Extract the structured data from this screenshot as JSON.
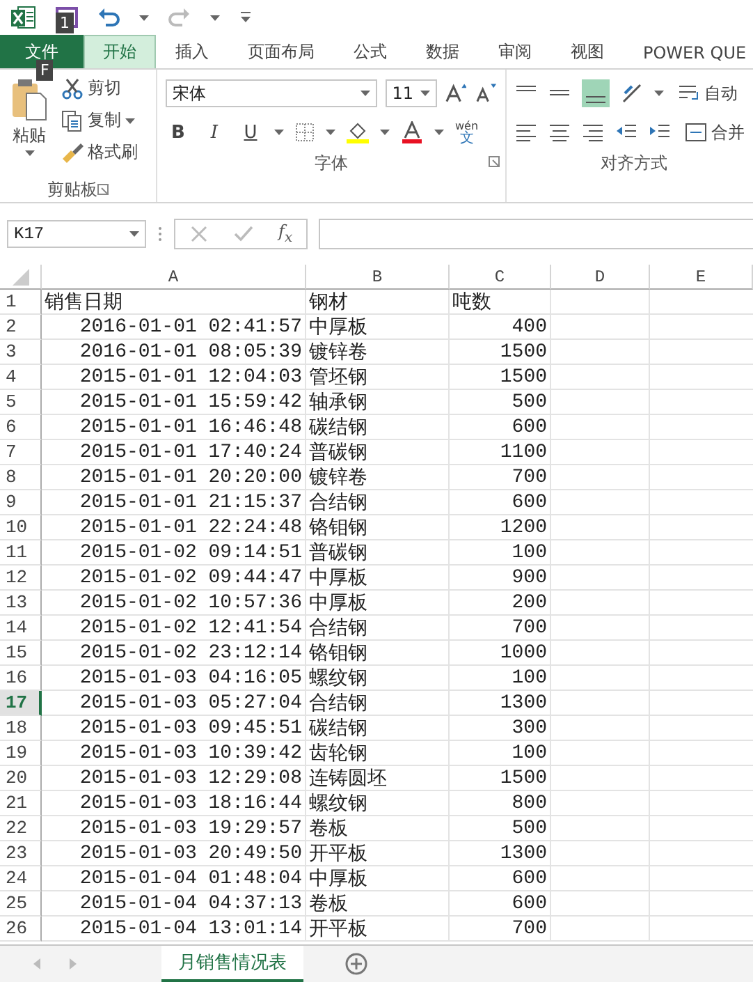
{
  "title_bar": {
    "keytip": "1"
  },
  "ribbon_tabs": [
    {
      "label": "文件",
      "kind": "file",
      "selected": false,
      "keytip": "F"
    },
    {
      "label": "开始",
      "kind": "tab",
      "selected": true
    },
    {
      "label": "插入",
      "kind": "tab",
      "selected": false
    },
    {
      "label": "页面布局",
      "kind": "tab",
      "selected": false
    },
    {
      "label": "公式",
      "kind": "tab",
      "selected": false
    },
    {
      "label": "数据",
      "kind": "tab",
      "selected": false
    },
    {
      "label": "审阅",
      "kind": "tab",
      "selected": false
    },
    {
      "label": "视图",
      "kind": "tab",
      "selected": false
    },
    {
      "label": "POWER QUE",
      "kind": "tab",
      "selected": false
    }
  ],
  "clipboard": {
    "paste": "粘贴",
    "cut": "剪切",
    "copy": "复制",
    "format_painter": "格式刷",
    "label": "剪贴板"
  },
  "font": {
    "name": "宋体",
    "size": "11",
    "label": "字体",
    "bold": "B",
    "italic": "I",
    "underline": "U",
    "phonetic": "wén",
    "phonetic_char": "文"
  },
  "alignment": {
    "wrap": "自动",
    "merge": "合并",
    "label": "对齐方式"
  },
  "formula_bar": {
    "name_box": "K17",
    "function_label": "f$_{x}$"
  },
  "sheet": {
    "columns": [
      "A",
      "B",
      "C",
      "D",
      "E"
    ],
    "rows": [
      {
        "number": "1",
        "kind": "header",
        "selected": false,
        "cells": [
          "销售日期",
          "钢材",
          "吨数"
        ]
      },
      {
        "number": "2",
        "kind": "data",
        "selected": false,
        "cells": [
          "2016-01-01 02:41:57",
          "中厚板",
          "400"
        ]
      },
      {
        "number": "3",
        "kind": "data",
        "selected": false,
        "cells": [
          "2016-01-01 08:05:39",
          "镀锌卷",
          "1500"
        ]
      },
      {
        "number": "4",
        "kind": "data",
        "selected": false,
        "cells": [
          "2015-01-01 12:04:03",
          "管坯钢",
          "1500"
        ]
      },
      {
        "number": "5",
        "kind": "data",
        "selected": false,
        "cells": [
          "2015-01-01 15:59:42",
          "轴承钢",
          "500"
        ]
      },
      {
        "number": "6",
        "kind": "data",
        "selected": false,
        "cells": [
          "2015-01-01 16:46:48",
          "碳结钢",
          "600"
        ]
      },
      {
        "number": "7",
        "kind": "data",
        "selected": false,
        "cells": [
          "2015-01-01 17:40:24",
          "普碳钢",
          "1100"
        ]
      },
      {
        "number": "8",
        "kind": "data",
        "selected": false,
        "cells": [
          "2015-01-01 20:20:00",
          "镀锌卷",
          "700"
        ]
      },
      {
        "number": "9",
        "kind": "data",
        "selected": false,
        "cells": [
          "2015-01-01 21:15:37",
          "合结钢",
          "600"
        ]
      },
      {
        "number": "10",
        "kind": "data",
        "selected": false,
        "cells": [
          "2015-01-01 22:24:48",
          "铬钼钢",
          "1200"
        ]
      },
      {
        "number": "11",
        "kind": "data",
        "selected": false,
        "cells": [
          "2015-01-02 09:14:51",
          "普碳钢",
          "100"
        ]
      },
      {
        "number": "12",
        "kind": "data",
        "selected": false,
        "cells": [
          "2015-01-02 09:44:47",
          "中厚板",
          "900"
        ]
      },
      {
        "number": "13",
        "kind": "data",
        "selected": false,
        "cells": [
          "2015-01-02 10:57:36",
          "中厚板",
          "200"
        ]
      },
      {
        "number": "14",
        "kind": "data",
        "selected": false,
        "cells": [
          "2015-01-02 12:41:54",
          "合结钢",
          "700"
        ]
      },
      {
        "number": "15",
        "kind": "data",
        "selected": false,
        "cells": [
          "2015-01-02 23:12:14",
          "铬钼钢",
          "1000"
        ]
      },
      {
        "number": "16",
        "kind": "data",
        "selected": false,
        "cells": [
          "2015-01-03 04:16:05",
          "螺纹钢",
          "100"
        ]
      },
      {
        "number": "17",
        "kind": "data",
        "selected": true,
        "cells": [
          "2015-01-03 05:27:04",
          "合结钢",
          "1300"
        ]
      },
      {
        "number": "18",
        "kind": "data",
        "selected": false,
        "cells": [
          "2015-01-03 09:45:51",
          "碳结钢",
          "300"
        ]
      },
      {
        "number": "19",
        "kind": "data",
        "selected": false,
        "cells": [
          "2015-01-03 10:39:42",
          "齿轮钢",
          "100"
        ]
      },
      {
        "number": "20",
        "kind": "data",
        "selected": false,
        "cells": [
          "2015-01-03 12:29:08",
          "连铸圆坯",
          "1500"
        ]
      },
      {
        "number": "21",
        "kind": "data",
        "selected": false,
        "cells": [
          "2015-01-03 18:16:44",
          "螺纹钢",
          "800"
        ]
      },
      {
        "number": "22",
        "kind": "data",
        "selected": false,
        "cells": [
          "2015-01-03 19:29:57",
          "卷板",
          "500"
        ]
      },
      {
        "number": "23",
        "kind": "data",
        "selected": false,
        "cells": [
          "2015-01-03 20:49:50",
          "开平板",
          "1300"
        ]
      },
      {
        "number": "24",
        "kind": "data",
        "selected": false,
        "cells": [
          "2015-01-04 01:48:04",
          "中厚板",
          "600"
        ]
      },
      {
        "number": "25",
        "kind": "data",
        "selected": false,
        "cells": [
          "2015-01-04 04:37:13",
          "卷板",
          "600"
        ]
      },
      {
        "number": "26",
        "kind": "data",
        "selected": false,
        "cells": [
          "2015-01-04 13:01:14",
          "开平板",
          "700"
        ]
      }
    ]
  },
  "sheet_tabs": [
    {
      "label": "月销售情况表",
      "selected": true
    }
  ]
}
